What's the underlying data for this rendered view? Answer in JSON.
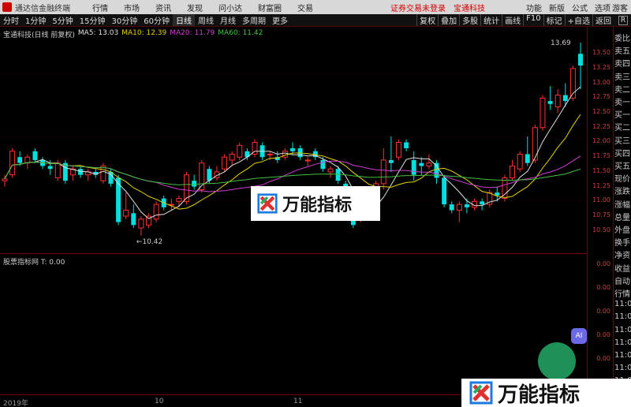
{
  "titlebar": {
    "app_name": "通达信金融终端",
    "menus": [
      "行情",
      "市场",
      "资讯",
      "发现",
      "问小达",
      "财富圈",
      "交易"
    ],
    "warning": "证券交易未登录",
    "stock": "宝通科技",
    "right_menus": [
      "功能",
      "新版",
      "公式",
      "选项"
    ],
    "guest": "游客"
  },
  "toolbar": {
    "periods": [
      "分时",
      "1分钟",
      "5分钟",
      "15分钟",
      "30分钟",
      "60分钟",
      "日线",
      "周线",
      "月线",
      "多周期",
      "更多"
    ],
    "active_period": "日线",
    "right_buttons": [
      "复权",
      "叠加",
      "多股",
      "统计",
      "画线",
      "F10",
      "标记",
      "+自选",
      "返回"
    ],
    "close_label": "R"
  },
  "ma_info": {
    "stock_label": "宝通科技(日线 前复权)",
    "ma5": "MA5: 13.03",
    "ma10": "MA10: 12.39",
    "ma20": "MA20: 11.79",
    "ma60": "MA60: 11.42"
  },
  "price_ticks": [
    "13.50",
    "13.25",
    "13.00",
    "12.75",
    "12.50",
    "12.25",
    "12.00",
    "11.75",
    "11.50",
    "11.25",
    "11.00",
    "10.75",
    "10.50"
  ],
  "side_labels": [
    "委比",
    "卖五",
    "卖四",
    "卖三",
    "卖二",
    "卖一",
    "买一",
    "买二",
    "买三",
    "买四",
    "买五",
    "现价",
    "涨跌",
    "涨幅",
    "总量",
    "外盘",
    "换手",
    "净资",
    "收益",
    "自动",
    "行情",
    "11:0",
    "11:0",
    "11:0",
    "11:0",
    "11:0",
    "11:0",
    "11:0"
  ],
  "sub_info": "股票指标网 T: 0.00",
  "sub_ticks": [
    "0.00",
    "0.00",
    "0.00",
    "0.00",
    "0.00",
    "0.00"
  ],
  "time_labels": [
    "2019年",
    "10",
    "11"
  ],
  "watermark_text": "万能指标",
  "ai_label": "AI",
  "colors": {
    "up": "#ff3030",
    "down": "#00e0e0",
    "ma5": "#e0e0e0",
    "ma10": "#e6d200",
    "ma20": "#d040d0",
    "ma60": "#40c040"
  },
  "chart_data": {
    "type": "candlestick",
    "ylim": [
      10.35,
      13.85
    ],
    "high_annotation": "13.69",
    "low_annotation": "←10.42",
    "candles": [
      {
        "o": 11.35,
        "h": 11.45,
        "l": 11.25,
        "c": 11.38
      },
      {
        "o": 11.45,
        "h": 11.9,
        "l": 11.4,
        "c": 11.85
      },
      {
        "o": 11.75,
        "h": 11.85,
        "l": 11.6,
        "c": 11.65
      },
      {
        "o": 11.65,
        "h": 11.8,
        "l": 11.55,
        "c": 11.75
      },
      {
        "o": 11.85,
        "h": 11.9,
        "l": 11.65,
        "c": 11.7
      },
      {
        "o": 11.7,
        "h": 11.75,
        "l": 11.55,
        "c": 11.6
      },
      {
        "o": 11.6,
        "h": 11.7,
        "l": 11.45,
        "c": 11.55
      },
      {
        "o": 11.4,
        "h": 11.7,
        "l": 11.35,
        "c": 11.65
      },
      {
        "o": 11.65,
        "h": 11.7,
        "l": 11.3,
        "c": 11.35
      },
      {
        "o": 11.45,
        "h": 11.6,
        "l": 11.35,
        "c": 11.55
      },
      {
        "o": 11.55,
        "h": 11.6,
        "l": 11.4,
        "c": 11.45
      },
      {
        "o": 11.45,
        "h": 11.55,
        "l": 11.35,
        "c": 11.5
      },
      {
        "o": 11.5,
        "h": 11.55,
        "l": 11.4,
        "c": 11.45
      },
      {
        "o": 11.35,
        "h": 11.65,
        "l": 11.3,
        "c": 11.6
      },
      {
        "o": 11.5,
        "h": 11.55,
        "l": 11.25,
        "c": 11.3
      },
      {
        "o": 11.4,
        "h": 11.45,
        "l": 10.6,
        "c": 10.65
      },
      {
        "o": 10.75,
        "h": 11.15,
        "l": 10.7,
        "c": 10.85
      },
      {
        "o": 10.8,
        "h": 10.95,
        "l": 10.55,
        "c": 10.6
      },
      {
        "o": 10.55,
        "h": 10.75,
        "l": 10.42,
        "c": 10.7
      },
      {
        "o": 10.6,
        "h": 10.8,
        "l": 10.55,
        "c": 10.75
      },
      {
        "o": 10.7,
        "h": 11.0,
        "l": 10.65,
        "c": 10.95
      },
      {
        "o": 11.05,
        "h": 11.1,
        "l": 10.85,
        "c": 10.9
      },
      {
        "o": 10.95,
        "h": 11.05,
        "l": 10.85,
        "c": 10.95
      },
      {
        "o": 11.0,
        "h": 11.1,
        "l": 10.9,
        "c": 11.05
      },
      {
        "o": 11.0,
        "h": 11.5,
        "l": 10.95,
        "c": 11.45
      },
      {
        "o": 11.35,
        "h": 11.45,
        "l": 11.2,
        "c": 11.25
      },
      {
        "o": 11.2,
        "h": 11.7,
        "l": 11.15,
        "c": 11.65
      },
      {
        "o": 11.55,
        "h": 11.6,
        "l": 11.3,
        "c": 11.35
      },
      {
        "o": 11.4,
        "h": 11.6,
        "l": 11.35,
        "c": 11.5
      },
      {
        "o": 11.55,
        "h": 11.8,
        "l": 11.5,
        "c": 11.75
      },
      {
        "o": 11.7,
        "h": 11.85,
        "l": 11.6,
        "c": 11.8
      },
      {
        "o": 11.75,
        "h": 12.0,
        "l": 11.7,
        "c": 11.95
      },
      {
        "o": 11.85,
        "h": 11.9,
        "l": 11.7,
        "c": 11.75
      },
      {
        "o": 11.8,
        "h": 12.05,
        "l": 11.75,
        "c": 12.0
      },
      {
        "o": 11.95,
        "h": 12.0,
        "l": 11.7,
        "c": 11.75
      },
      {
        "o": 11.8,
        "h": 11.85,
        "l": 11.7,
        "c": 11.8
      },
      {
        "o": 11.75,
        "h": 11.85,
        "l": 11.65,
        "c": 11.7
      },
      {
        "o": 11.75,
        "h": 11.9,
        "l": 11.7,
        "c": 11.85
      },
      {
        "o": 11.9,
        "h": 12.0,
        "l": 11.8,
        "c": 11.85
      },
      {
        "o": 11.9,
        "h": 11.95,
        "l": 11.7,
        "c": 11.75
      },
      {
        "o": 11.7,
        "h": 11.75,
        "l": 11.6,
        "c": 11.7
      },
      {
        "o": 11.85,
        "h": 11.9,
        "l": 11.7,
        "c": 11.75
      },
      {
        "o": 11.7,
        "h": 11.75,
        "l": 11.5,
        "c": 11.55
      },
      {
        "o": 11.5,
        "h": 11.6,
        "l": 11.4,
        "c": 11.55
      },
      {
        "o": 11.55,
        "h": 11.6,
        "l": 11.3,
        "c": 11.35
      },
      {
        "o": 11.3,
        "h": 11.35,
        "l": 10.9,
        "c": 10.95
      },
      {
        "o": 11.0,
        "h": 11.05,
        "l": 10.55,
        "c": 10.6
      },
      {
        "o": 10.7,
        "h": 10.95,
        "l": 10.65,
        "c": 10.9
      },
      {
        "o": 10.9,
        "h": 10.95,
        "l": 10.75,
        "c": 10.85
      },
      {
        "o": 10.85,
        "h": 11.35,
        "l": 10.8,
        "c": 11.3
      },
      {
        "o": 11.3,
        "h": 11.9,
        "l": 11.2,
        "c": 11.7
      },
      {
        "o": 11.7,
        "h": 12.1,
        "l": 11.5,
        "c": 11.65
      },
      {
        "o": 11.75,
        "h": 12.05,
        "l": 11.7,
        "c": 12.0
      },
      {
        "o": 12.0,
        "h": 12.05,
        "l": 11.85,
        "c": 11.9
      },
      {
        "o": 11.7,
        "h": 11.85,
        "l": 11.35,
        "c": 11.45
      },
      {
        "o": 11.65,
        "h": 11.75,
        "l": 11.45,
        "c": 11.6
      },
      {
        "o": 11.6,
        "h": 11.8,
        "l": 11.55,
        "c": 11.65
      },
      {
        "o": 11.65,
        "h": 11.7,
        "l": 11.3,
        "c": 11.4
      },
      {
        "o": 11.4,
        "h": 11.45,
        "l": 10.9,
        "c": 10.95
      },
      {
        "o": 10.95,
        "h": 11.0,
        "l": 10.8,
        "c": 10.85
      },
      {
        "o": 10.85,
        "h": 11.0,
        "l": 10.65,
        "c": 10.95
      },
      {
        "o": 10.95,
        "h": 11.05,
        "l": 10.8,
        "c": 10.9
      },
      {
        "o": 10.9,
        "h": 11.05,
        "l": 10.85,
        "c": 11.0
      },
      {
        "o": 11.0,
        "h": 11.05,
        "l": 10.85,
        "c": 10.95
      },
      {
        "o": 10.95,
        "h": 11.2,
        "l": 10.9,
        "c": 11.15
      },
      {
        "o": 11.15,
        "h": 11.25,
        "l": 11.0,
        "c": 11.1
      },
      {
        "o": 11.05,
        "h": 11.45,
        "l": 11.0,
        "c": 11.4
      },
      {
        "o": 11.4,
        "h": 11.7,
        "l": 11.35,
        "c": 11.6
      },
      {
        "o": 11.55,
        "h": 11.85,
        "l": 11.5,
        "c": 11.8
      },
      {
        "o": 11.8,
        "h": 12.1,
        "l": 11.6,
        "c": 11.65
      },
      {
        "o": 11.7,
        "h": 12.3,
        "l": 11.65,
        "c": 12.25
      },
      {
        "o": 12.25,
        "h": 12.8,
        "l": 12.2,
        "c": 12.75
      },
      {
        "o": 12.7,
        "h": 12.95,
        "l": 12.55,
        "c": 12.65
      },
      {
        "o": 12.6,
        "h": 12.9,
        "l": 12.5,
        "c": 12.8
      },
      {
        "o": 12.8,
        "h": 13.0,
        "l": 12.6,
        "c": 12.7
      },
      {
        "o": 12.75,
        "h": 13.3,
        "l": 12.7,
        "c": 13.25
      },
      {
        "o": 13.5,
        "h": 13.69,
        "l": 12.9,
        "c": 13.3
      }
    ]
  }
}
